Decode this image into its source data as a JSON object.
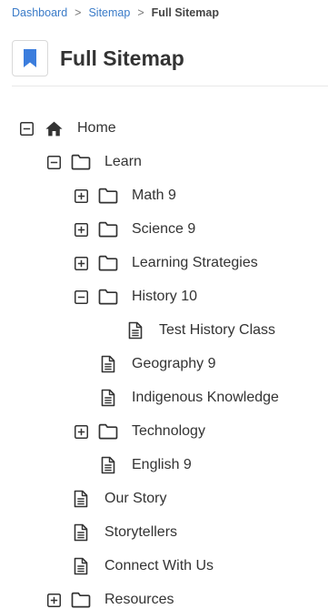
{
  "breadcrumb": {
    "items": [
      "Dashboard",
      "Sitemap"
    ],
    "separator": ">",
    "current": "Full Sitemap"
  },
  "page": {
    "title": "Full Sitemap",
    "icon": "bookmark-icon",
    "accent_color": "#3b7ddd"
  },
  "tree": [
    {
      "label": "Home",
      "type": "home",
      "toggle": "collapse"
    },
    {
      "label": "Learn",
      "type": "folder",
      "toggle": "collapse"
    },
    {
      "label": "Math 9",
      "type": "folder",
      "toggle": "expand"
    },
    {
      "label": "Science 9",
      "type": "folder",
      "toggle": "expand"
    },
    {
      "label": "Learning Strategies",
      "type": "folder",
      "toggle": "expand"
    },
    {
      "label": "History 10",
      "type": "folder",
      "toggle": "collapse"
    },
    {
      "label": "Test History Class",
      "type": "page",
      "toggle": "none"
    },
    {
      "label": "Geography 9",
      "type": "page",
      "toggle": "none"
    },
    {
      "label": "Indigenous Knowledge",
      "type": "page",
      "toggle": "none"
    },
    {
      "label": "Technology",
      "type": "folder",
      "toggle": "expand"
    },
    {
      "label": "English 9",
      "type": "page",
      "toggle": "none"
    },
    {
      "label": "Our Story",
      "type": "page",
      "toggle": "none"
    },
    {
      "label": "Storytellers",
      "type": "page",
      "toggle": "none"
    },
    {
      "label": "Connect With Us",
      "type": "page",
      "toggle": "none"
    },
    {
      "label": "Resources",
      "type": "folder",
      "toggle": "expand"
    }
  ]
}
